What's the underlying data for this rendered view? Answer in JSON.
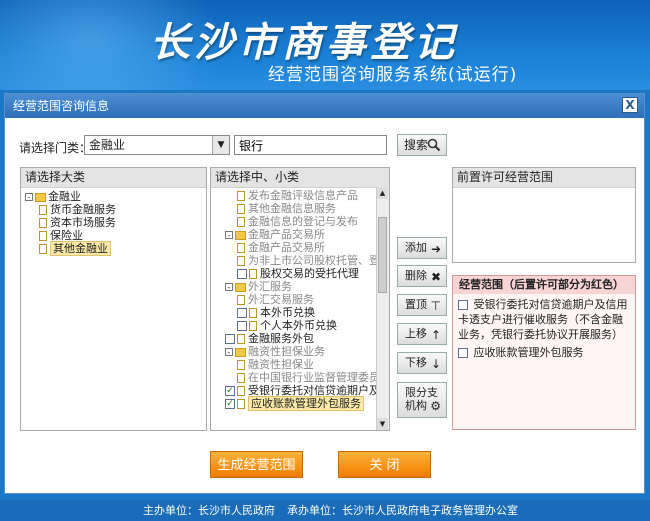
{
  "banner": {
    "title": "长沙市商事登记",
    "subtitle": "经营范围咨询服务系统(试运行)"
  },
  "dialog": {
    "title": "经营范围咨询信息",
    "close_label": "X",
    "category_label": "请选择门类：",
    "category_value": "金融业",
    "keyword_value": "银行",
    "search_label": "搜索"
  },
  "left_panel": {
    "header": "请选择大类",
    "items": [
      {
        "label": "金融业",
        "level": 0,
        "type": "folder",
        "expander": "-"
      },
      {
        "label": "货币金融服务",
        "level": 1,
        "type": "doc"
      },
      {
        "label": "资本市场服务",
        "level": 1,
        "type": "doc"
      },
      {
        "label": "保险业",
        "level": 1,
        "type": "doc"
      },
      {
        "label": "其他金融业",
        "level": 1,
        "type": "doc",
        "selected": true
      }
    ]
  },
  "mid_panel": {
    "header": "请选择中、小类",
    "items": [
      {
        "label": "发布金融评级信息产品",
        "level": 2,
        "type": "doc",
        "muted": true
      },
      {
        "label": "其他金融信息服务",
        "level": 2,
        "type": "doc",
        "muted": true
      },
      {
        "label": "金融信息的登记与发布",
        "level": 2,
        "type": "doc",
        "muted": true
      },
      {
        "label": "金融产品交易所",
        "level": 1,
        "type": "folder",
        "muted": true
      },
      {
        "label": "金融产品交易所",
        "level": 2,
        "type": "doc",
        "muted": true
      },
      {
        "label": "为非上市公司股权托管、登",
        "level": 2,
        "type": "doc",
        "muted": true
      },
      {
        "label": "股权交易的受托代理",
        "level": 2,
        "type": "check",
        "checked": false
      },
      {
        "label": "外汇服务",
        "level": 1,
        "type": "folder",
        "muted": true
      },
      {
        "label": "外汇交易服务",
        "level": 2,
        "type": "doc",
        "muted": true
      },
      {
        "label": "本外币兑换",
        "level": 2,
        "type": "check",
        "checked": false
      },
      {
        "label": "个人本外币兑换",
        "level": 2,
        "type": "check",
        "checked": false
      },
      {
        "label": "金融服务外包",
        "level": 1,
        "type": "check",
        "checked": false
      },
      {
        "label": "融资性担保业务",
        "level": 1,
        "type": "folder",
        "muted": true
      },
      {
        "label": "融资性担保业",
        "level": 2,
        "type": "doc",
        "muted": true
      },
      {
        "label": "在中国银行业监督管理委员",
        "level": 2,
        "type": "doc",
        "muted": true
      },
      {
        "label": "受银行委托对信贷逾期户及",
        "level": 1,
        "type": "check",
        "checked": true
      },
      {
        "label": "应收账款管理外包服务",
        "level": 1,
        "type": "check",
        "checked": true,
        "selected": true
      }
    ]
  },
  "buttons": {
    "add": "添加",
    "delete": "删除",
    "top": "置顶",
    "up": "上移",
    "down": "下移",
    "restrict_line1": "限分支",
    "restrict_line2": "机构"
  },
  "prelicense_panel": {
    "header": "前置许可经营范围"
  },
  "scope_panel": {
    "header": "经营范围（后置许可部分为红色）",
    "items": [
      "受银行委托对信贷逾期户及信用卡透支户进行催收服务（不含金融业务，凭银行委托协议开展服务）",
      "应收账款管理外包服务"
    ]
  },
  "actions": {
    "generate": "生成经营范围",
    "close": "关 闭"
  },
  "footer": {
    "host": "主办单位：长沙市人民政府",
    "organizer": "承办单位：长沙市人民政府电子政务管理办公室"
  }
}
